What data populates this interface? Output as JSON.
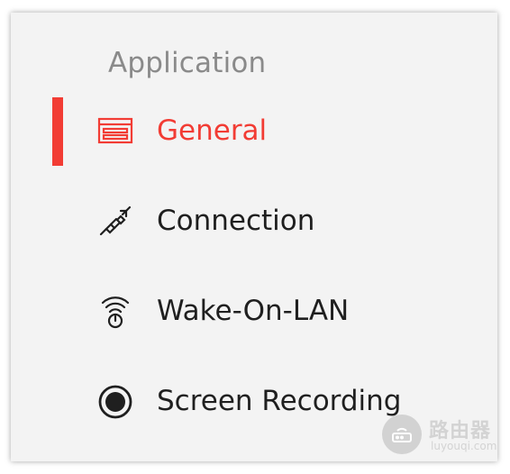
{
  "section": {
    "title": "Application"
  },
  "nav": {
    "items": [
      {
        "label": "General",
        "icon": "general-icon",
        "active": true
      },
      {
        "label": "Connection",
        "icon": "connection-icon",
        "active": false
      },
      {
        "label": "Wake-On-LAN",
        "icon": "wake-on-lan-icon",
        "active": false
      },
      {
        "label": "Screen Recording",
        "icon": "record-icon",
        "active": false
      }
    ]
  },
  "watermark": {
    "text": "路由器",
    "url": "luyouqi.com"
  },
  "colors": {
    "accent": "#f23c34",
    "text": "#1f1f1f",
    "muted": "#8a8a8a",
    "panel": "#f3f3f3"
  }
}
